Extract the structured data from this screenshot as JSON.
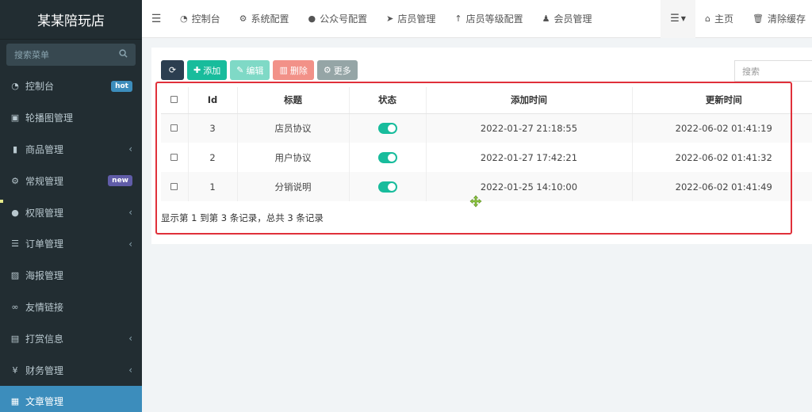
{
  "sidebar": {
    "brand": "某某陪玩店",
    "search_placeholder": "搜索菜单",
    "items": [
      {
        "label": "控制台",
        "icon": "dashboard-icon",
        "badge": "hot"
      },
      {
        "label": "轮播图管理",
        "icon": "image-icon"
      },
      {
        "label": "商品管理",
        "icon": "book-icon",
        "expandable": true
      },
      {
        "label": "常规管理",
        "icon": "cogs-icon",
        "badge": "new"
      },
      {
        "label": "权限管理",
        "icon": "users-icon",
        "expandable": true
      },
      {
        "label": "订单管理",
        "icon": "list-icon",
        "expandable": true
      },
      {
        "label": "海报管理",
        "icon": "picture-icon"
      },
      {
        "label": "友情链接",
        "icon": "link-icon"
      },
      {
        "label": "打赏信息",
        "icon": "gift-icon",
        "expandable": true
      },
      {
        "label": "财务管理",
        "icon": "yen-icon",
        "expandable": true
      },
      {
        "label": "文章管理",
        "icon": "article-icon",
        "active": true
      }
    ]
  },
  "topnav": {
    "tabs": [
      {
        "label": "控制台",
        "icon": "dashboard-icon"
      },
      {
        "label": "系统配置",
        "icon": "cog-icon"
      },
      {
        "label": "公众号配置",
        "icon": "wechat-icon"
      },
      {
        "label": "店员管理",
        "icon": "send-icon"
      },
      {
        "label": "店员等级配置",
        "icon": "level-up-icon"
      },
      {
        "label": "会员管理",
        "icon": "user-icon"
      }
    ],
    "home_label": "主页",
    "clear_cache_label": "清除缓存"
  },
  "toolbar": {
    "add_label": "添加",
    "edit_label": "编辑",
    "delete_label": "删除",
    "more_label": "更多",
    "search_placeholder": "搜索"
  },
  "table": {
    "headers": [
      "Id",
      "标题",
      "状态",
      "添加时间",
      "更新时间"
    ],
    "rows": [
      {
        "id": "3",
        "title": "店员协议",
        "status": "on",
        "created": "2022-01-27 21:18:55",
        "updated": "2022-06-02 01:41:19"
      },
      {
        "id": "2",
        "title": "用户协议",
        "status": "on",
        "created": "2022-01-27 17:42:21",
        "updated": "2022-06-02 01:41:32"
      },
      {
        "id": "1",
        "title": "分销说明",
        "status": "on",
        "created": "2022-01-25 14:10:00",
        "updated": "2022-06-02 01:41:49"
      }
    ],
    "pagination_info": "显示第 1 到第 3 条记录，总共 3 条记录"
  },
  "colors": {
    "sidebar_bg": "#222d32",
    "active_menu": "#3c8dbc",
    "success": "#18bc9c",
    "highlight": "#e0303a"
  }
}
